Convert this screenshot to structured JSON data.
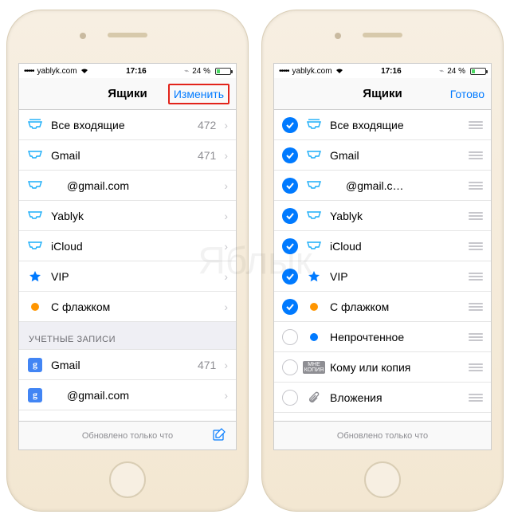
{
  "statusbar": {
    "carrier": "yablyk.com",
    "time": "17:16",
    "battery_pct": "24 %"
  },
  "watermark": "Яблык",
  "left": {
    "nav_title": "Ящики",
    "nav_action": "Изменить",
    "rows": [
      {
        "label": "Все входящие",
        "count": "472",
        "icon": "inbox-all"
      },
      {
        "label": "Gmail",
        "count": "471",
        "icon": "inbox"
      },
      {
        "label": "@gmail.com",
        "count": "",
        "icon": "inbox",
        "indented": true
      },
      {
        "label": "Yablyk",
        "count": "",
        "icon": "inbox"
      },
      {
        "label": "iCloud",
        "count": "",
        "icon": "inbox"
      },
      {
        "label": "VIP",
        "count": "",
        "icon": "star"
      },
      {
        "label": "С флажком",
        "count": "",
        "icon": "flag-dot"
      }
    ],
    "section_header": "УЧЕТНЫЕ ЗАПИСИ",
    "accounts": [
      {
        "label": "Gmail",
        "count": "471",
        "icon": "google"
      },
      {
        "label": "@gmail.com",
        "count": "",
        "icon": "google",
        "indented": true
      }
    ],
    "footer": "Обновлено только что"
  },
  "right": {
    "nav_title": "Ящики",
    "nav_action": "Готово",
    "rows": [
      {
        "checked": true,
        "label": "Все входящие",
        "icon": "inbox-all"
      },
      {
        "checked": true,
        "label": "Gmail",
        "icon": "inbox"
      },
      {
        "checked": true,
        "label": "@gmail.c…",
        "icon": "inbox",
        "indented": true
      },
      {
        "checked": true,
        "label": "Yablyk",
        "icon": "inbox"
      },
      {
        "checked": true,
        "label": "iCloud",
        "icon": "inbox"
      },
      {
        "checked": true,
        "label": "VIP",
        "icon": "star"
      },
      {
        "checked": true,
        "label": "С флажком",
        "icon": "flag-dot"
      },
      {
        "checked": false,
        "label": "Непрочтенное",
        "icon": "blue-dot"
      },
      {
        "checked": false,
        "label": "Кому или копия",
        "icon": "tocc"
      },
      {
        "checked": false,
        "label": "Вложения",
        "icon": "paperclip"
      }
    ],
    "footer": "Обновлено только что"
  }
}
